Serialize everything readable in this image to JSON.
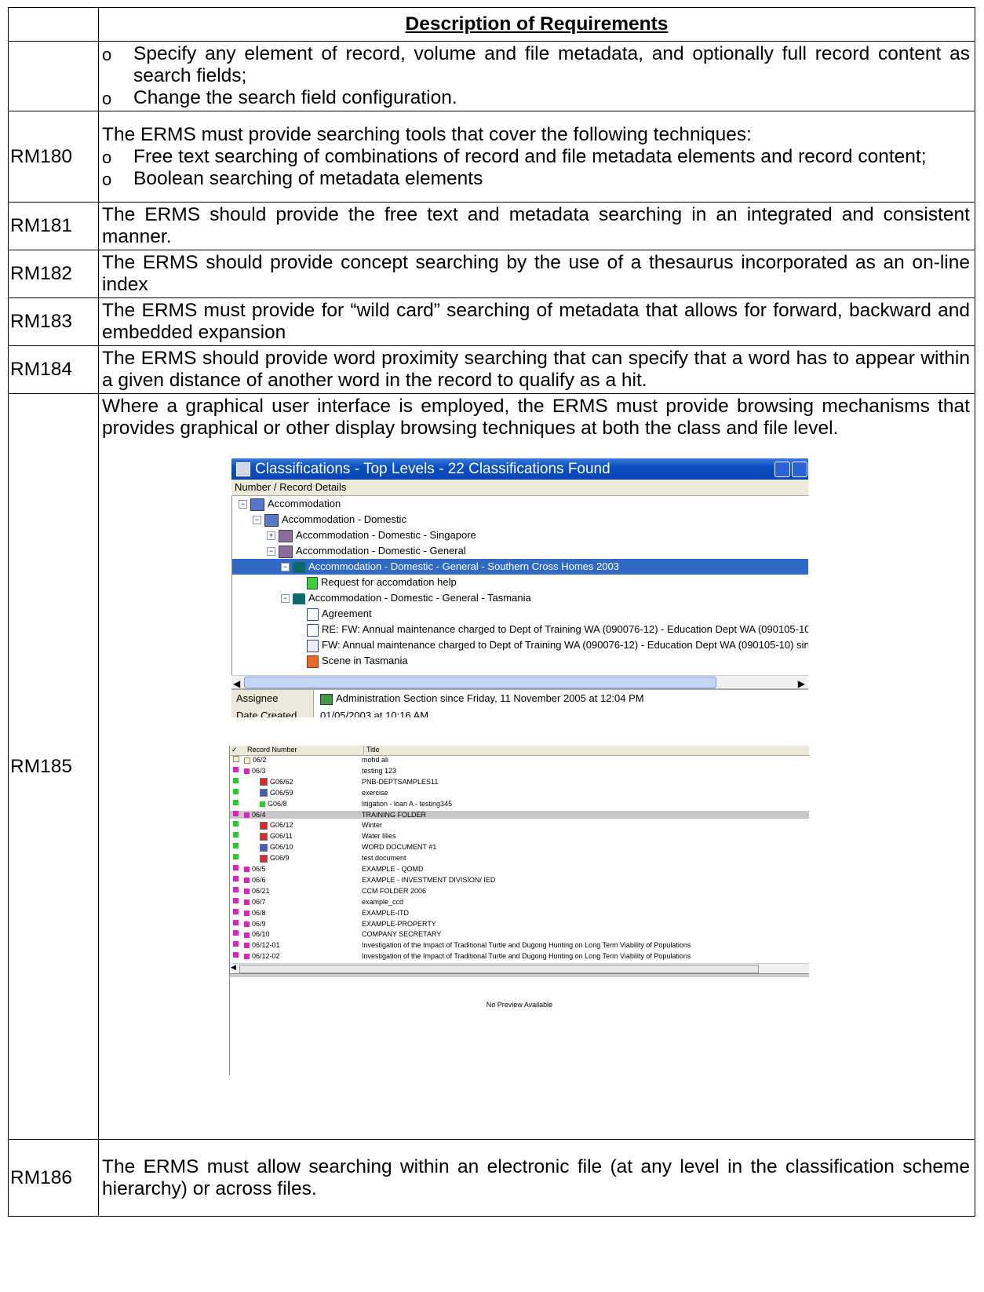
{
  "header": {
    "id_col": "",
    "desc_col": "Description of Requirements"
  },
  "row0": {
    "bullets": [
      "Specify any element of record, volume and file metadata, and optionally full record content as search fields;",
      "Change the search field configuration."
    ]
  },
  "row_rm180": {
    "id": "RM180",
    "intro": "The ERMS must provide searching tools that cover the following techniques:",
    "bullets": [
      "Free text searching of combinations of record and file metadata elements and record content;",
      "Boolean searching of metadata elements"
    ]
  },
  "row_rm181": {
    "id": "RM181",
    "text": "The ERMS should provide the free text and metadata searching in an integrated and consistent manner."
  },
  "row_rm182": {
    "id": "RM182",
    "text": "The ERMS should provide concept searching by the use of a thesaurus incorporated as an on-line index"
  },
  "row_rm183": {
    "id": "RM183",
    "text": "The ERMS must provide for “wild card” searching of metadata that allows for forward, backward and embedded expansion"
  },
  "row_rm184": {
    "id": "RM184",
    "text": "The ERMS should provide word proximity searching that can specify that a word has to appear within a given distance of another word in the record to qualify as a hit."
  },
  "row_rm185": {
    "id": "RM185",
    "text": "Where a graphical user interface is employed, the ERMS must provide browsing mechanisms that provides graphical or other display browsing techniques at both the class and file level."
  },
  "row_rm186": {
    "id": "RM186",
    "text": "The ERMS must allow searching within an electronic file (at any level in the classification scheme hierarchy) or across files."
  },
  "bullet_glyph": "o",
  "shot1": {
    "title": "Classifications - Top Levels - 22 Classifications Found",
    "column": "Number / Record Details",
    "tree": [
      {
        "text": "Accommodation",
        "icon": "arrow-icon"
      },
      {
        "text": "Accommodation - Domestic",
        "icon": "arrow-icon"
      },
      {
        "text": "Accommodation - Domestic - Singapore",
        "icon": "book-icon"
      },
      {
        "text": "Accommodation - Domestic - General",
        "icon": "book-icon"
      },
      {
        "text": "Accommodation - Domestic - General - Southern Cross Homes 2003",
        "icon": "folder-icon",
        "selected": true
      },
      {
        "text": "Request for accomdation help",
        "icon": "document-icon"
      },
      {
        "text": "Accommodation - Domestic - General - Tasmania",
        "icon": "folder-icon"
      },
      {
        "text": "Agreement",
        "icon": "word-icon"
      },
      {
        "text": "RE: FW: Annual maintenance charged to Dept of Training WA (090076-12) - Education Dept WA (090105-10",
        "icon": "word-icon"
      },
      {
        "text": "FW: Annual maintenance charged to Dept of Training WA (090076-12) - Education Dept WA (090105-10) sinc",
        "icon": "email-icon"
      },
      {
        "text": "Scene in Tasmania",
        "icon": "image-icon"
      }
    ],
    "props": [
      {
        "key": "Assignee",
        "value": "Administration Section since Friday, 11 November 2005 at 12:04 PM"
      },
      {
        "key": "Date Created",
        "value": "01/05/2003 at 10:16 AM"
      }
    ]
  },
  "shot2": {
    "columns": [
      "Record Number",
      "Title"
    ],
    "rows": [
      {
        "num": "06/2",
        "title": "mohd ali",
        "type": "folder-closed"
      },
      {
        "num": "06/3",
        "title": "testing 123",
        "type": "folder"
      },
      {
        "num": "G06/62",
        "title": "PNB-DEPTSAMPLES11",
        "type": "pdf"
      },
      {
        "num": "G06/59",
        "title": "exercise",
        "type": "word"
      },
      {
        "num": "G06/8",
        "title": "litigation - loan A - testing345",
        "type": "doc"
      },
      {
        "num": "06/4",
        "title": "TRAINING FOLDER",
        "type": "folder",
        "selected": true
      },
      {
        "num": "G06/12",
        "title": "Winter",
        "type": "pdf"
      },
      {
        "num": "G06/11",
        "title": "Water lilies",
        "type": "pdf"
      },
      {
        "num": "G06/10",
        "title": "WORD DOCUMENT #1",
        "type": "word"
      },
      {
        "num": "G06/9",
        "title": "test document",
        "type": "pdf"
      },
      {
        "num": "06/5",
        "title": "EXAMPLE - QOMD",
        "type": "folder"
      },
      {
        "num": "06/6",
        "title": "EXAMPLE - INVESTMENT DIVISION/ IED",
        "type": "folder"
      },
      {
        "num": "06/21",
        "title": "CCM FOLDER 2006",
        "type": "folder"
      },
      {
        "num": "06/7",
        "title": "example_ccd",
        "type": "folder"
      },
      {
        "num": "06/8",
        "title": "EXAMPLE-ITD",
        "type": "folder"
      },
      {
        "num": "06/9",
        "title": "EXAMPLE-PROPERTY",
        "type": "folder"
      },
      {
        "num": "06/10",
        "title": "COMPANY SECRETARY",
        "type": "folder"
      },
      {
        "num": "06/12-01",
        "title": "Investigation of the Impact of Traditional Turtle and Dugong Hunting on Long Term Viability of Populations",
        "type": "folder"
      },
      {
        "num": "06/12-02",
        "title": "Investigation of the Impact of Traditional Turtle and Dugong Hunting on Long Term Viability of Populations",
        "type": "folder"
      }
    ],
    "preview": "No Preview Available"
  }
}
